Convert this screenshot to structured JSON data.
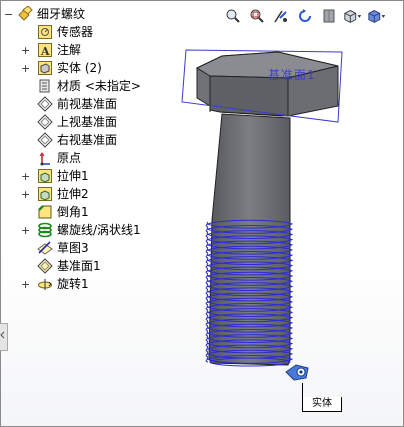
{
  "tree": {
    "root_label": "细牙螺纹",
    "items": [
      {
        "label": "传感器",
        "icon": "sensor-icon",
        "expandable": false
      },
      {
        "label": "注解",
        "icon": "annotation-icon",
        "expandable": true
      },
      {
        "label": "实体 (2)",
        "icon": "solid-bodies-icon",
        "expandable": true
      },
      {
        "label": "材质 <未指定>",
        "icon": "material-icon",
        "expandable": false
      },
      {
        "label": "前视基准面",
        "icon": "plane-icon",
        "expandable": false
      },
      {
        "label": "上视基准面",
        "icon": "plane-icon",
        "expandable": false
      },
      {
        "label": "右视基准面",
        "icon": "plane-icon",
        "expandable": false
      },
      {
        "label": "原点",
        "icon": "origin-icon",
        "expandable": false
      },
      {
        "label": "拉伸1",
        "icon": "extrude-icon",
        "expandable": true
      },
      {
        "label": "拉伸2",
        "icon": "extrude-icon",
        "expandable": true
      },
      {
        "label": "倒角1",
        "icon": "chamfer-icon",
        "expandable": false
      },
      {
        "label": "螺旋线/涡状线1",
        "icon": "helix-icon",
        "expandable": true
      },
      {
        "label": "草图3",
        "icon": "sketch-icon",
        "expandable": false
      },
      {
        "label": "基准面1",
        "icon": "plane-icon",
        "expandable": false
      },
      {
        "label": "旋转1",
        "icon": "revolve-icon",
        "expandable": true
      }
    ]
  },
  "toolbar": {
    "buttons": [
      "zoom-fit-icon",
      "zoom-area-icon",
      "previous-view-icon",
      "rotate-icon",
      "section-view-icon",
      "view-orientation-icon",
      "display-style-icon"
    ]
  },
  "viewport": {
    "plane_label": "基准面1",
    "tag_label": "实体",
    "colors": {
      "plane": "#3a3acc",
      "helix": "#2b2bd6",
      "body_dark": "#5e6066",
      "body_light": "#9c9ea4"
    }
  }
}
